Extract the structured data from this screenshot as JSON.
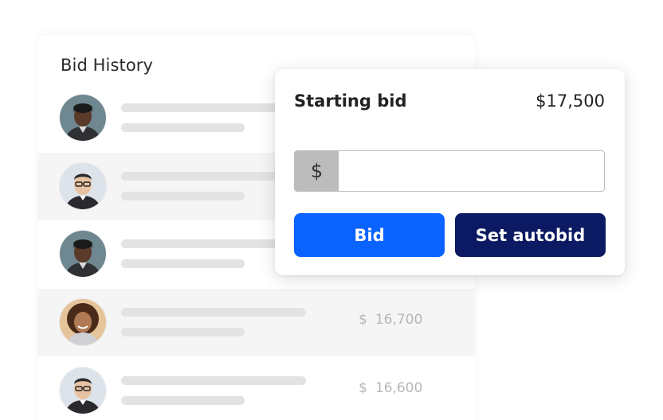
{
  "history": {
    "title": "Bid History",
    "rows": [
      {
        "avatar": "avatar-man-dark-skin",
        "amount": "",
        "currency": ""
      },
      {
        "avatar": "avatar-man-glasses",
        "amount": "",
        "currency": ""
      },
      {
        "avatar": "avatar-man-dark-skin",
        "amount": "",
        "currency": ""
      },
      {
        "avatar": "avatar-woman-curly-hair",
        "amount": "16,700",
        "currency": "$"
      },
      {
        "avatar": "avatar-man-glasses",
        "amount": "16,600",
        "currency": "$"
      }
    ]
  },
  "panel": {
    "starting_bid_label": "Starting bid",
    "starting_bid_value": "$17,500",
    "currency_prefix": "$",
    "input_value": "",
    "bid_button": "Bid",
    "autobid_button": "Set autobid"
  },
  "colors": {
    "primary_blue": "#0b63ff",
    "navy": "#0c1a63",
    "row_shade": "#f5f5f5",
    "placeholder_line": "#e3e3e3"
  }
}
